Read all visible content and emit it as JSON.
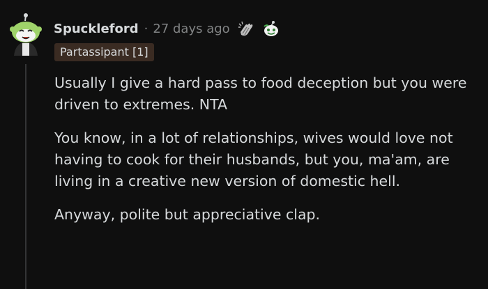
{
  "comment": {
    "username": "Spuckleford",
    "separator": "·",
    "timestamp": "27 days ago",
    "awards": [
      {
        "icon": "clap-hands-icon"
      },
      {
        "icon": "snoo-face-icon"
      }
    ],
    "flair": "Partassipant [1]",
    "paragraphs": [
      "Usually I give a hard pass to food deception but you were driven to extremes. NTA",
      "You know, in a lot of relationships, wives would love not having to cook for their husbands, but you, ma'am, are living in a creative new version of domestic hell.",
      "Anyway, polite but appreciative clap."
    ]
  },
  "colors": {
    "background": "#0f0f0f",
    "text": "#d7dadc",
    "meta": "#818384",
    "flair_bg": "#3a2b22",
    "avatar_green": "#9fd36a"
  }
}
